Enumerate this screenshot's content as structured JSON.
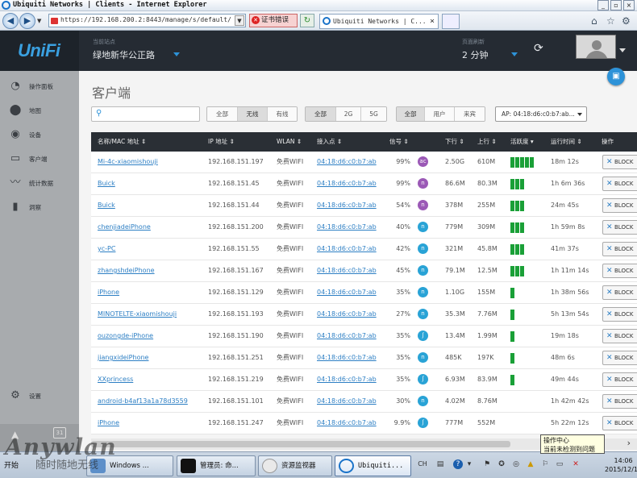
{
  "window": {
    "title": "Ubiquiti Networks | Clients - Internet Explorer",
    "url": "https://192.168.200.2:8443/manage/s/default/",
    "cert_error": "证书错误",
    "tab_title": "Ubiquiti Networks | C..."
  },
  "topbar": {
    "logo": "UniFi",
    "site_label": "当前站点",
    "site_value": "绿地新华公正路",
    "refresh_label": "页面刷新",
    "refresh_value": "2 分钟"
  },
  "sidebar": {
    "items": [
      {
        "label": "操作面板",
        "icon": "dashboard-icon"
      },
      {
        "label": "地图",
        "icon": "map-pin-icon"
      },
      {
        "label": "设备",
        "icon": "device-icon"
      },
      {
        "label": "客户端",
        "icon": "laptop-icon"
      },
      {
        "label": "统计数据",
        "icon": "stats-icon"
      },
      {
        "label": "洞察",
        "icon": "insights-icon"
      }
    ],
    "settings_label": "设置",
    "calendar_badge": "31"
  },
  "page": {
    "title": "客户端",
    "search_placeholder": "",
    "filter_type": [
      "全部",
      "无线",
      "有线"
    ],
    "filter_band": [
      "全部",
      "2G",
      "5G"
    ],
    "filter_user": [
      "全部",
      "用户",
      "来宾"
    ],
    "ap_select": "AP: 04:18:d6:c0:b7:ab..."
  },
  "table": {
    "headers": {
      "name": "名称/MAC 地址 ⇕",
      "ip": "IP 地址 ⇕",
      "wlan": "WLAN ⇕",
      "ap": "接入点 ⇕",
      "signal": "信号 ⇕",
      "down": "下行 ⇕",
      "up": "上行 ⇕",
      "activity": "活跃度 ▾",
      "uptime": "运行时间 ⇕",
      "action": "操作"
    },
    "block_label": "BLOCK",
    "rows": [
      {
        "name": "Mi-4c-xiaomishouji",
        "ip": "192.168.151.197",
        "wlan": "免费WIFI",
        "ap": "04:18:d6:c0:b7:ab",
        "signal": "99%",
        "radio": "ac",
        "down": "2.50G",
        "up": "610M",
        "activity": 5,
        "uptime": "18m 12s"
      },
      {
        "name": "Buick",
        "ip": "192.168.151.45",
        "wlan": "免费WIFI",
        "ap": "04:18:d6:c0:b7:ab",
        "signal": "99%",
        "radio": "n",
        "down": "86.6M",
        "up": "80.3M",
        "activity": 3,
        "uptime": "1h 6m 36s"
      },
      {
        "name": "Buick",
        "ip": "192.168.151.44",
        "wlan": "免费WIFI",
        "ap": "04:18:d6:c0:b7:ab",
        "signal": "54%",
        "radio": "n",
        "down": "378M",
        "up": "255M",
        "activity": 3,
        "uptime": "24m 45s"
      },
      {
        "name": "chenjiadeiPhone",
        "ip": "192.168.151.200",
        "wlan": "免费WIFI",
        "ap": "04:18:d6:c0:b7:ab",
        "signal": "40%",
        "radio": "n-blue",
        "down": "779M",
        "up": "309M",
        "activity": 3,
        "uptime": "1h 59m 8s"
      },
      {
        "name": "yc-PC",
        "ip": "192.168.151.55",
        "wlan": "免费WIFI",
        "ap": "04:18:d6:c0:b7:ab",
        "signal": "42%",
        "radio": "n-blue",
        "down": "321M",
        "up": "45.8M",
        "activity": 3,
        "uptime": "41m 37s"
      },
      {
        "name": "zhangshdeiPhone",
        "ip": "192.168.151.167",
        "wlan": "免费WIFI",
        "ap": "04:18:d6:c0:b7:ab",
        "signal": "45%",
        "radio": "n-blue",
        "down": "79.1M",
        "up": "12.5M",
        "activity": 3,
        "uptime": "1h 11m 14s"
      },
      {
        "name": "iPhone",
        "ip": "192.168.151.129",
        "wlan": "免费WIFI",
        "ap": "04:18:d6:c0:b7:ab",
        "signal": "35%",
        "radio": "n-blue",
        "down": "1.10G",
        "up": "155M",
        "activity": 1,
        "uptime": "1h 38m 56s"
      },
      {
        "name": "MINOTELTE-xiaomishouji",
        "ip": "192.168.151.193",
        "wlan": "免费WIFI",
        "ap": "04:18:d6:c0:b7:ab",
        "signal": "27%",
        "radio": "n-blue",
        "down": "35.3M",
        "up": "7.76M",
        "activity": 1,
        "uptime": "5h 13m 54s"
      },
      {
        "name": "ouzongde-iPhone",
        "ip": "192.168.151.190",
        "wlan": "免费WIFI",
        "ap": "04:18:d6:c0:b7:ab",
        "signal": "35%",
        "radio": "g",
        "down": "13.4M",
        "up": "1.99M",
        "activity": 1,
        "uptime": "19m 18s"
      },
      {
        "name": "jiangxideiPhone",
        "ip": "192.168.151.251",
        "wlan": "免费WIFI",
        "ap": "04:18:d6:c0:b7:ab",
        "signal": "35%",
        "radio": "n-blue",
        "down": "485K",
        "up": "197K",
        "activity": 1,
        "uptime": "48m 6s"
      },
      {
        "name": "XXprincess",
        "ip": "192.168.151.219",
        "wlan": "免费WIFI",
        "ap": "04:18:d6:c0:b7:ab",
        "signal": "35%",
        "radio": "g",
        "down": "6.93M",
        "up": "83.9M",
        "activity": 1,
        "uptime": "49m 44s"
      },
      {
        "name": "android-b4af13a1a78d3559",
        "ip": "192.168.151.101",
        "wlan": "免费WIFI",
        "ap": "04:18:d6:c0:b7:ab",
        "signal": "30%",
        "radio": "n-blue",
        "down": "4.02M",
        "up": "8.76M",
        "activity": 0,
        "uptime": "1h 42m 42s"
      },
      {
        "name": "iPhone",
        "ip": "192.168.151.247",
        "wlan": "免费WIFI",
        "ap": "04:18:d6:c0:b7:ab",
        "signal": "9.9%",
        "radio": "g",
        "down": "777M",
        "up": "552M",
        "activity": 0,
        "uptime": "5h 22m 12s"
      }
    ]
  },
  "taskbar": {
    "start": "开始",
    "tasks": [
      "Windows ...",
      "管理员: 命...",
      "资源监视器",
      "Ubiquiti..."
    ],
    "lang": "CH",
    "tooltip_title": "操作中心",
    "tooltip_body": "当前未检测到问题",
    "time": "14:06",
    "date": "2015/12/14"
  },
  "watermark": {
    "brand": "Anywlan",
    "slogan": "随时随地无线"
  },
  "colors": {
    "accent": "#2d92d8",
    "topbar": "#252b33",
    "activity": "#1aa037"
  }
}
